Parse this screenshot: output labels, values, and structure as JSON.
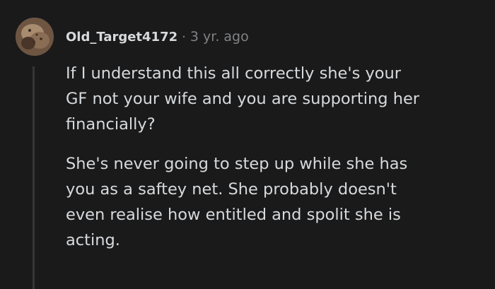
{
  "comment": {
    "username": "Old_Target4172",
    "separator": "·",
    "timestamp": "3 yr. ago",
    "avatar_icon": "user-avatar-icon",
    "paragraphs": [
      "If I understand this all correctly she's your\nGF not your wife and you are supporting her\nfinancially?",
      "She's never going to step up while she has\nyou as a saftey net. She probably doesn't\neven realise how entitled and spolit she is\nacting."
    ]
  },
  "colors": {
    "background": "#1a1a1b",
    "text": "#d7dadc",
    "meta": "#818384",
    "thread_line": "#343536"
  }
}
